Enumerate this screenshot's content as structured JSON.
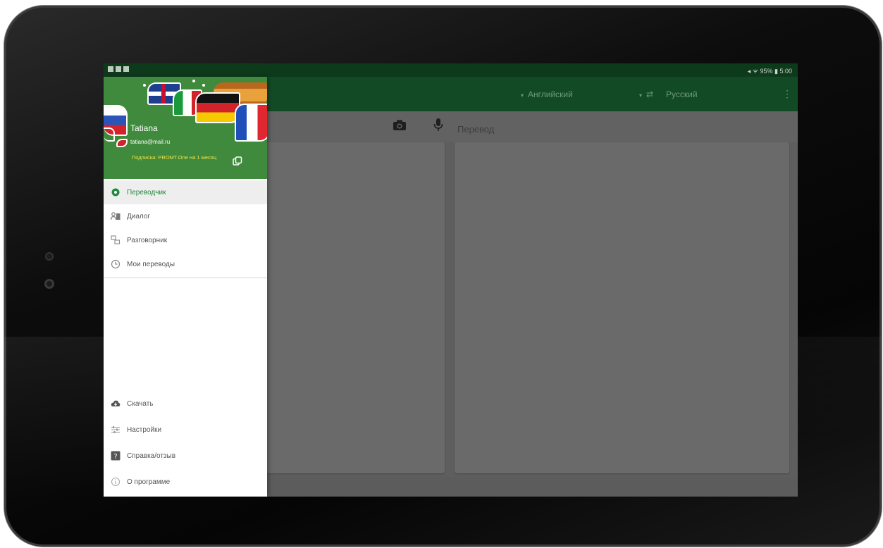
{
  "status_bar": {
    "right_text": "◂ ᯤ 95% ▮ 5:00"
  },
  "app_bar": {
    "source_language": "Английский",
    "swap_symbol": "⇄",
    "target_language": "Русский",
    "more_symbol": "⋮",
    "caret": "▾"
  },
  "input_toolbar": {
    "translate_label": "Перевод"
  },
  "drawer": {
    "user_name": "Tatiana",
    "user_email": "tatiana@mail.ru",
    "subscription_text": "Подписка: PROMT.One на 1 месяц",
    "top_items": [
      {
        "label": "Переводчик",
        "icon": "translator-icon",
        "active": true
      },
      {
        "label": "Диалог",
        "icon": "dialog-icon",
        "active": false
      },
      {
        "label": "Разговорник",
        "icon": "phrasebook-icon",
        "active": false
      },
      {
        "label": "Мои переводы",
        "icon": "history-icon",
        "active": false
      }
    ],
    "bottom_items": [
      {
        "label": "Скачать",
        "icon": "cloud-download-icon"
      },
      {
        "label": "Настройки",
        "icon": "settings-icon"
      },
      {
        "label": "Справка/отзыв",
        "icon": "help-icon"
      },
      {
        "label": "О программе",
        "icon": "info-icon"
      }
    ]
  },
  "colors": {
    "app_bar_green": "#134a26",
    "header_green": "#3f8a3c",
    "active_green": "#1f8a3c",
    "subscription_yellow": "#f1e34a"
  }
}
